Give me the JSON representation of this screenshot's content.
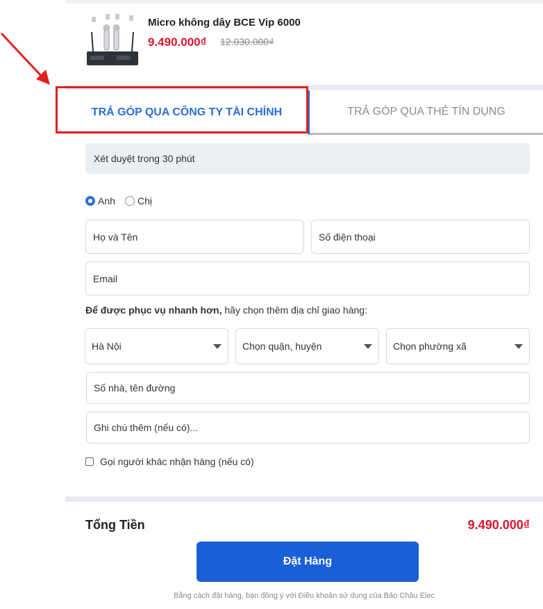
{
  "product": {
    "name": "Micro không dây BCE Vip 6000",
    "price": "9.490.000₫",
    "old_price": "12.030.000₫",
    "image_icon": "wireless-microphone-set-image"
  },
  "tabs": [
    {
      "label": "TRẢ GÓP QUA CÔNG TY TÀI CHÍNH",
      "active": true
    },
    {
      "label": "TRẢ GÓP QUA THẺ TÍN DỤNG",
      "active": false
    }
  ],
  "info_bar": "Xét duyệt trong 30 phút",
  "gender": {
    "options": [
      "Anh",
      "Chị"
    ],
    "selected": "Anh"
  },
  "form": {
    "name_placeholder": "Họ và Tên",
    "phone_placeholder": "Số điện thoại",
    "email_placeholder": "Email",
    "hint_bold": "Để được phục vụ nhanh hơn,",
    "hint_rest": " hãy chọn thêm địa chỉ giao hàng:",
    "city": "Hà Nội",
    "district": "Chọn quận, huyện",
    "ward": "Chọn phường xã",
    "address_placeholder": "Số nhà, tên đường",
    "note_placeholder": "Ghi chú thêm (nếu có)...",
    "other_receiver": "Gọi người khác nhận hàng (nếu có)",
    "other_receiver_checked": false
  },
  "summary": {
    "total_label": "Tổng Tiền",
    "total_value": "9.490.000₫",
    "order_button": "Đặt Hàng",
    "terms": "Bằng cách đặt hàng, bạn đồng ý với Điều khoản sử dụng của Bảo Châu Elec"
  },
  "colors": {
    "accent": "#2b6fd6",
    "button": "#1a5fd6",
    "price": "#e0152d",
    "highlight": "#e0201f"
  }
}
